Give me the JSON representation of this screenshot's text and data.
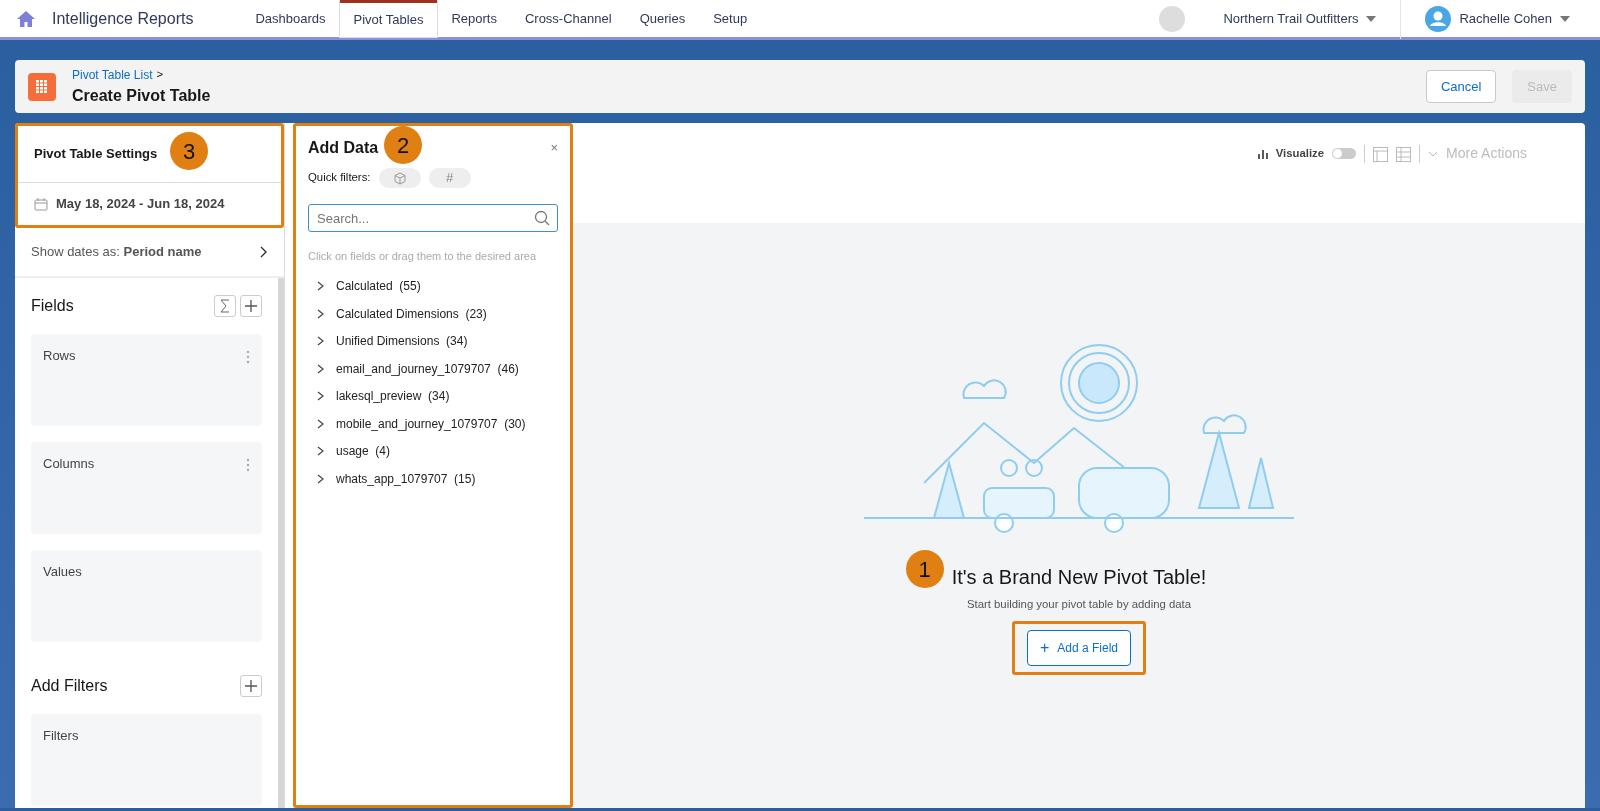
{
  "app": {
    "title": "Intelligence Reports"
  },
  "nav_tabs": [
    {
      "label": "Dashboards",
      "selected": false
    },
    {
      "label": "Pivot Tables",
      "selected": true
    },
    {
      "label": "Reports",
      "selected": false
    },
    {
      "label": "Cross-Channel",
      "selected": false
    },
    {
      "label": "Queries",
      "selected": false
    },
    {
      "label": "Setup",
      "selected": false
    }
  ],
  "org": {
    "name": "Northern Trail Outfitters"
  },
  "user": {
    "name": "Rachelle Cohen"
  },
  "header": {
    "breadcrumb": "Pivot Table List",
    "separator": ">",
    "title": "Create Pivot Table",
    "buttons": [
      {
        "label": "Cancel",
        "disabled": false
      },
      {
        "label": "Save",
        "disabled": true
      }
    ]
  },
  "settings": {
    "title": "Pivot Table Settings",
    "callout": "3",
    "date_range": "May 18, 2024 - Jun 18, 2024",
    "show_dates_label": "Show dates as:",
    "show_dates_value": "Period name",
    "fields_title": "Fields",
    "zones": [
      "Rows",
      "Columns",
      "Values"
    ],
    "filters_title": "Add Filters",
    "filters_zone": "Filters"
  },
  "add_data": {
    "title": "Add Data",
    "callout": "2",
    "close": "×",
    "quick_filters_label": "Quick filters:",
    "quick_filters": [
      {
        "kind": "cube"
      },
      {
        "kind": "hash",
        "text": "#"
      }
    ],
    "search_placeholder": "Search...",
    "hint": "Click on fields or drag them to the desired area",
    "groups": [
      {
        "name": "Calculated",
        "count": "(55)",
        "expanded": false
      },
      {
        "name": "Calculated Dimensions",
        "count": "(23)",
        "expanded": false
      },
      {
        "name": "Unified Dimensions",
        "count": "(34)",
        "expanded": false
      },
      {
        "name": "email_and_journey_1079707",
        "count": "(46)",
        "expanded": false
      },
      {
        "name": "lakesql_preview",
        "count": "(34)",
        "expanded": false
      },
      {
        "name": "mobile_and_journey_1079707",
        "count": "(30)",
        "expanded": false
      },
      {
        "name": "usage",
        "count": "(4)",
        "expanded": false
      },
      {
        "name": "whats_app_1079707",
        "count": "(15)",
        "expanded": false
      }
    ]
  },
  "toolbar": {
    "visualize": {
      "label": "Visualize",
      "on": false
    },
    "more_actions": "More Actions"
  },
  "empty_state": {
    "callout": "1",
    "title": "It's a Brand New Pivot Table!",
    "subtitle": "Start building your pivot table by adding data",
    "button": "Add a Field",
    "button_icon": "+"
  }
}
